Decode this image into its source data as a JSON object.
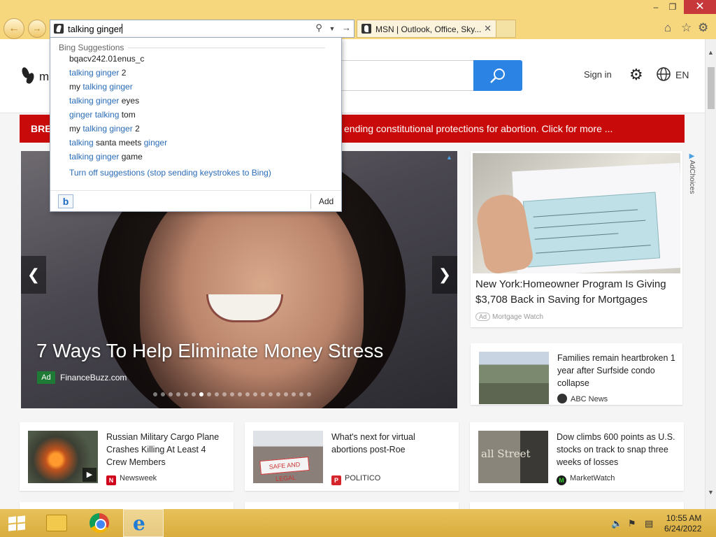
{
  "browser": {
    "address_value": "talking ginger",
    "tab_title": "MSN | Outlook, Office, Sky...",
    "window_controls": [
      "minimize-icon",
      "restore-icon",
      "close-icon"
    ],
    "toolbar_icons": [
      "home-icon",
      "favorites-star-icon",
      "settings-gear-icon"
    ]
  },
  "suggestions": {
    "header": "Bing Suggestions",
    "items": [
      {
        "pre": "bqacv242.01enus_c",
        "mid": "",
        "post": "",
        "highlight": "none"
      },
      {
        "pre": "",
        "mid": "talking ginger",
        "post": " 2",
        "highlight": "mid"
      },
      {
        "pre": "my ",
        "mid": "talking ginger",
        "post": "",
        "highlight": "mid"
      },
      {
        "pre": "",
        "mid": "talking ginger",
        "post": " eyes",
        "highlight": "mid"
      },
      {
        "pre": "",
        "mid": "ginger talking",
        "post": " tom",
        "highlight": "mid"
      },
      {
        "pre": "my ",
        "mid": "talking ginger",
        "post": " 2",
        "highlight": "mid"
      },
      {
        "pre": "",
        "mid": "talking",
        "post": " santa meets ",
        "tail": "ginger",
        "highlight": "mid"
      },
      {
        "pre": "",
        "mid": "talking ginger",
        "post": " game",
        "highlight": "mid"
      }
    ],
    "turn_off_label": "Turn off suggestions (stop sending keystrokes to Bing)",
    "add_label": "Add"
  },
  "msn": {
    "logo_text": "m",
    "signin": "Sign in",
    "language": "EN",
    "breaking_label": "BRE",
    "breaking_text": "ending constitutional protections for abortion. Click for more ...",
    "hero": {
      "title": "7 Ways To Help Eliminate Money Stress",
      "ad_label": "Ad",
      "source": "FinanceBuzz.com",
      "dot_count": 21,
      "active_dot": 6
    },
    "ad_card": {
      "title": "New York:Homeowner Program Is Giving $3,708 Back in Saving for Mortgages",
      "ad_box": "Ad",
      "sponsor": "Mortgage Watch"
    },
    "adchoices": "AdChoices",
    "news": [
      {
        "title": "Families remain heartbroken 1 year after Surfside condo collapse",
        "source": "ABC News"
      },
      {
        "title": "Russian Military Cargo Plane Crashes Killing At Least 4 Crew Members",
        "source": "Newsweek"
      },
      {
        "title": "What's next for virtual abortions post-Roe",
        "source": "POLITICO"
      },
      {
        "title": "Dow climbs 600 points as U.S. stocks on track to snap three weeks of losses",
        "source": "MarketWatch"
      }
    ]
  },
  "taskbar": {
    "apps": [
      "windows-start-icon",
      "file-explorer-icon",
      "chrome-icon",
      "internet-explorer-icon"
    ],
    "time": "10:55 AM",
    "date": "6/24/2022"
  },
  "colors": {
    "chrome_bg": "#f6d77e",
    "breaking_red": "#c90a0a",
    "search_blue": "#2b83e3",
    "link_blue": "#2b6cb8",
    "taskbar": "#d9ad3e"
  }
}
